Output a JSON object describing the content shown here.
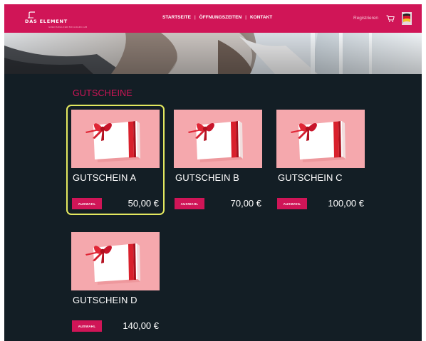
{
  "brand": {
    "name": "DAS ELEMENT",
    "tagline": "GREIFSWALDER BOULDERCLUB"
  },
  "header": {
    "nav": [
      {
        "label": "STARTSEITE"
      },
      {
        "label": "ÖFFNUNGSZEITEN"
      },
      {
        "label": "KONTAKT"
      }
    ],
    "nav_separator": "|",
    "register_label": "Registrieren",
    "cart_icon": "cart-icon",
    "language_icon": "german-flag-icon"
  },
  "colors": {
    "brand": "#d01557",
    "background": "#131e25",
    "card_image_bg": "#f5a8ad",
    "selected_outline": "#e3e85f"
  },
  "main": {
    "title": "GUTSCHEINE",
    "vouchers": [
      {
        "title": "GUTSCHEIN A",
        "button_label": "AUSWAHL",
        "price": "50,00 €",
        "selected": true
      },
      {
        "title": "GUTSCHEIN B",
        "button_label": "AUSWAHL",
        "price": "70,00 €",
        "selected": false
      },
      {
        "title": "GUTSCHEIN C",
        "button_label": "AUSWAHL",
        "price": "100,00 €",
        "selected": false
      },
      {
        "title": "GUTSCHEIN D",
        "button_label": "AUSWAHL",
        "price": "140,00 €",
        "selected": false
      }
    ]
  }
}
